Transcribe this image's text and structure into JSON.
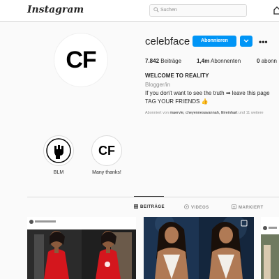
{
  "header": {
    "logo": "Instagram",
    "search_placeholder": "Suchen"
  },
  "profile": {
    "avatar_text": "CF",
    "username": "celebface",
    "follow_label": "Abonnieren",
    "stats": {
      "posts_value": "7.842",
      "posts_label": "Beiträge",
      "followers_value": "1,4m",
      "followers_label": "Abonnenten",
      "following_value": "0",
      "following_label": "abonn"
    },
    "bio": {
      "name": "WELCOME TO REALITY",
      "category": "Blogger/in",
      "line1": "If you don't want to see the truth ➡ leave this page",
      "line2": "TAG YOUR FRIENDS 👍"
    },
    "followed_by": {
      "prefix": "Abonniert von ",
      "names": "maervle, cheyennesavannah, lilireinhart",
      "suffix": " und 11 weitere"
    }
  },
  "highlights": [
    {
      "label": "BLM"
    },
    {
      "label": "Many thanks!",
      "avatar_text": "CF"
    }
  ],
  "tabs": [
    {
      "label": "BEITRÄGE",
      "icon": "grid-icon",
      "active": true
    },
    {
      "label": "VIDEOS",
      "icon": "video-icon",
      "active": false
    },
    {
      "label": "MARKIERT",
      "icon": "tag-icon",
      "active": false
    }
  ],
  "colors": {
    "accent": "#0095f6",
    "text": "#262626",
    "muted": "#8e8e8e",
    "border": "#dbdbdb"
  }
}
